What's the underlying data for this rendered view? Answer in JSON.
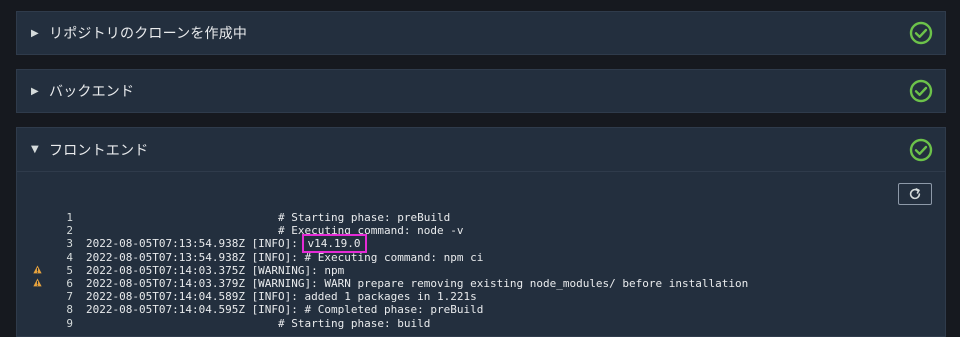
{
  "panels": [
    {
      "title": "リポジトリのクローンを作成中",
      "expanded": false,
      "status": "success"
    },
    {
      "title": "バックエンド",
      "expanded": false,
      "status": "success"
    },
    {
      "title": "フロントエンド",
      "expanded": true,
      "status": "success"
    }
  ],
  "icons": {
    "caret_collapsed": "▶",
    "caret_expanded": "▼",
    "status": "check-circle-icon",
    "refresh": "refresh-icon",
    "warning": "warning-icon"
  },
  "colors": {
    "success": "#6cc24a",
    "highlight": "#e52bd6",
    "warning": "#e8a33d"
  },
  "log": {
    "lines": [
      {
        "n": "1",
        "warn": false,
        "text": "                             # Starting phase: preBuild"
      },
      {
        "n": "2",
        "warn": false,
        "text": "                             # Executing command: node -v"
      },
      {
        "n": "3",
        "warn": false,
        "prefix": "2022-08-05T07:13:54.938Z [INFO]: ",
        "highlight": "v14.19.0",
        "text": ""
      },
      {
        "n": "4",
        "warn": false,
        "text": "2022-08-05T07:13:54.938Z [INFO]: # Executing command: npm ci"
      },
      {
        "n": "5",
        "warn": true,
        "text": "2022-08-05T07:14:03.375Z [WARNING]: npm"
      },
      {
        "n": "6",
        "warn": true,
        "text": "2022-08-05T07:14:03.379Z [WARNING]: WARN prepare removing existing node_modules/ before installation"
      },
      {
        "n": "7",
        "warn": false,
        "text": "2022-08-05T07:14:04.589Z [INFO]: added 1 packages in 1.221s"
      },
      {
        "n": "8",
        "warn": false,
        "text": "2022-08-05T07:14:04.595Z [INFO]: # Completed phase: preBuild"
      },
      {
        "n": "9",
        "warn": false,
        "text": "                             # Starting phase: build"
      }
    ]
  }
}
